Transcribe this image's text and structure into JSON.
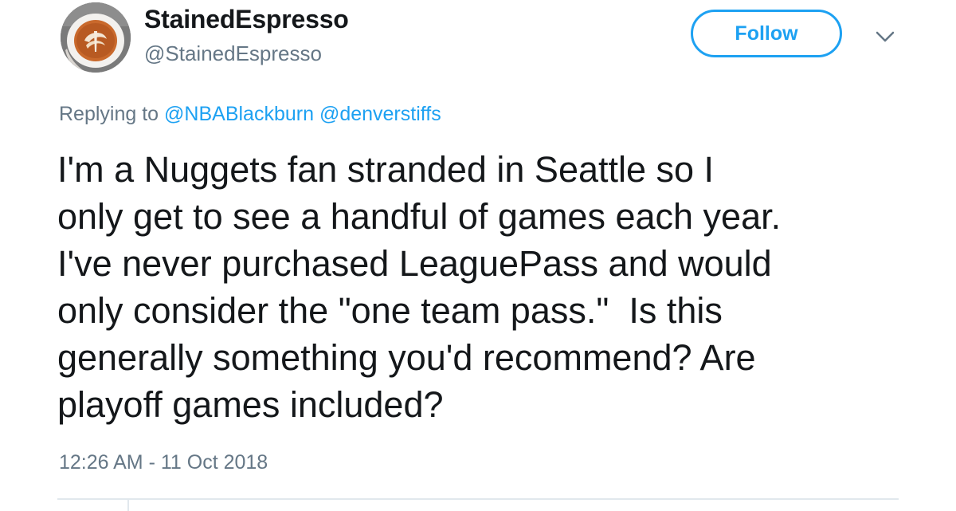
{
  "author": {
    "display_name": "StainedEspresso",
    "handle": "@StainedEspresso",
    "avatar_icon": "latte-art-cup-icon"
  },
  "actions": {
    "follow_label": "Follow",
    "menu_icon": "chevron-down-icon"
  },
  "reply": {
    "prefix": "Replying to",
    "mentions": [
      "@NBABlackburn",
      "@denverstiffs"
    ]
  },
  "tweet": {
    "lines": [
      "I'm a Nuggets fan stranded in Seattle so I",
      "only get to see a handful of games each year.",
      "I've never purchased LeaguePass and would",
      "only consider the \"one team pass.\"  Is this",
      "generally something you'd recommend? Are",
      "playoff games included?"
    ],
    "timestamp": "12:26 AM - 11 Oct 2018"
  },
  "colors": {
    "accent": "#1da1f2",
    "text": "#14171a",
    "secondary_text": "#657786",
    "divider": "#e1e8ed"
  }
}
